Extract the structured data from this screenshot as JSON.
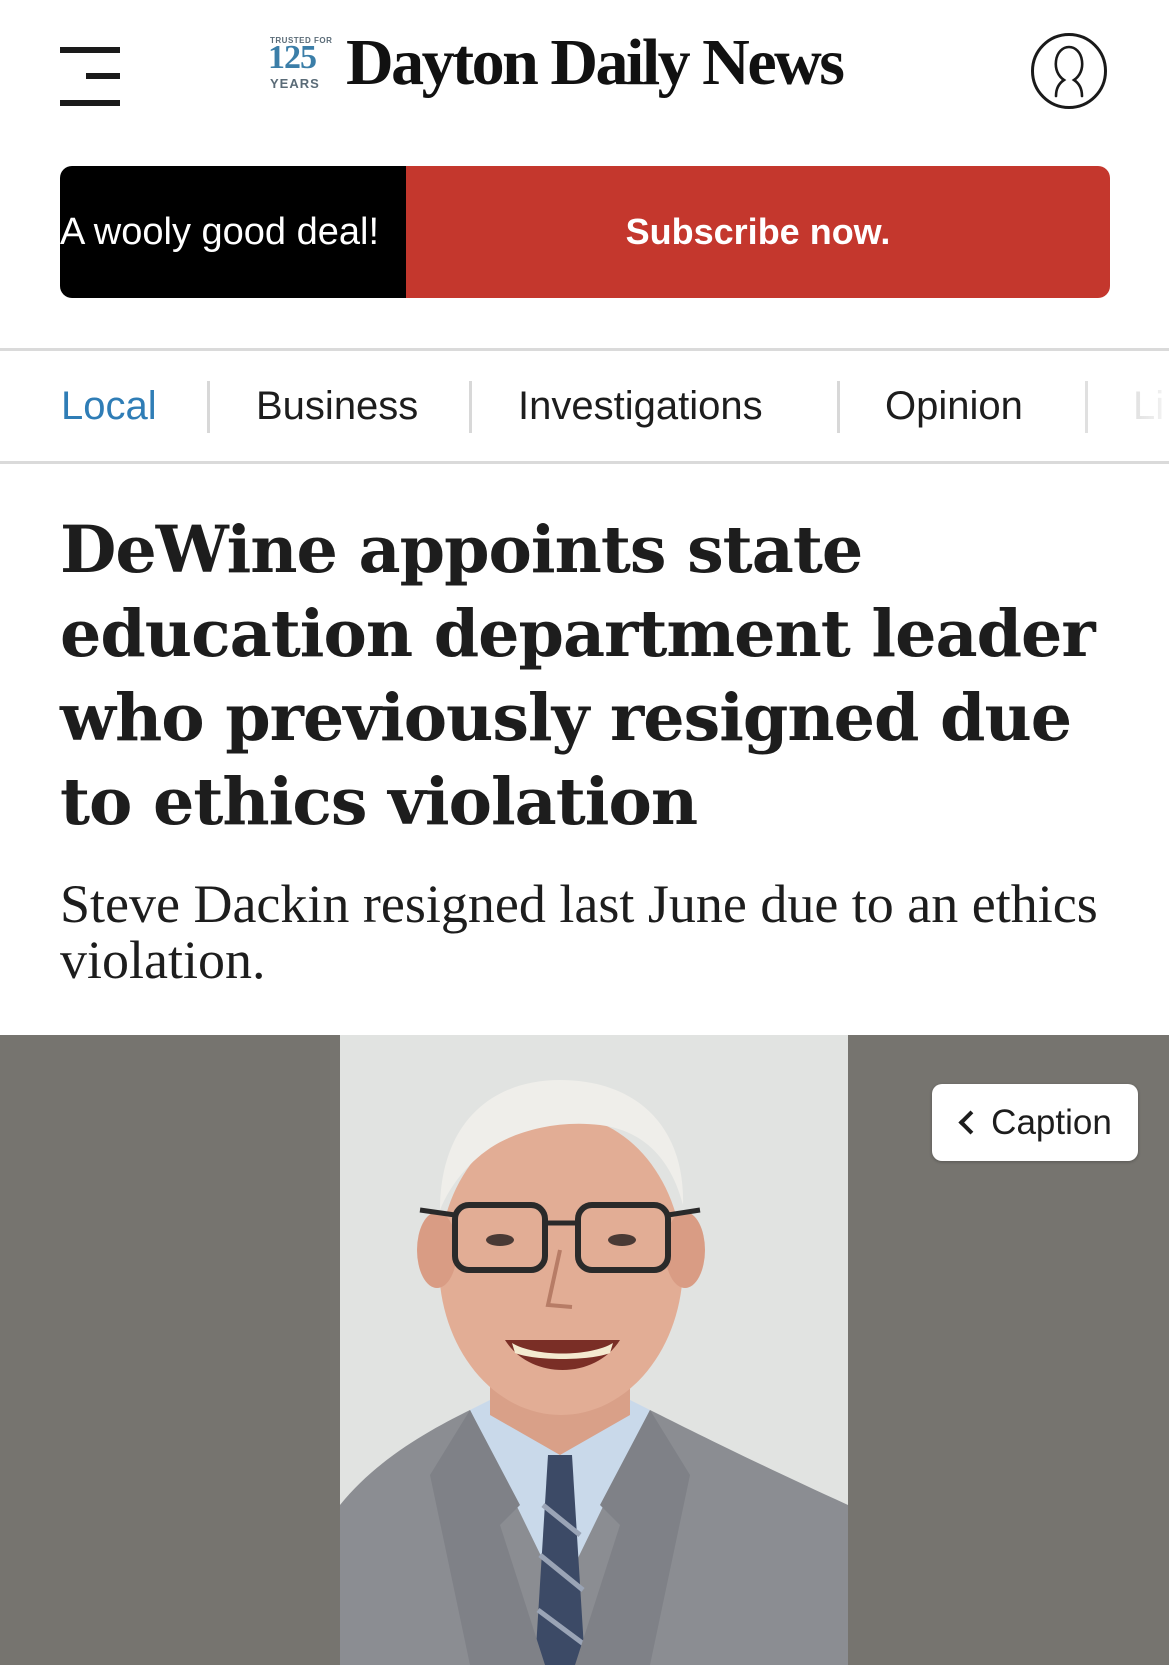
{
  "header": {
    "badge_small_text": "TRUSTED FOR",
    "badge_number": "125",
    "badge_years": "YEARS",
    "site_name": "Dayton Daily News",
    "menu_icon": "hamburger-menu-icon",
    "account_icon": "user-account-icon"
  },
  "promo": {
    "tagline": "A wooly good deal!",
    "cta_label": "Subscribe now.",
    "cta_color": "#c4372d"
  },
  "nav": {
    "items": [
      {
        "label": "Local"
      },
      {
        "label": "Business"
      },
      {
        "label": "Investigations"
      },
      {
        "label": "Opinion"
      },
      {
        "label": "Li"
      }
    ],
    "active_color": "#2f7db6"
  },
  "article": {
    "headline": "DeWine appoints state education department leader who previously resigned due to ethics violation",
    "subheadline": "Steve Dackin resigned last June due to an ethics violation."
  },
  "photo": {
    "caption_button_label": "Caption",
    "caption_icon": "chevron-left-icon"
  }
}
